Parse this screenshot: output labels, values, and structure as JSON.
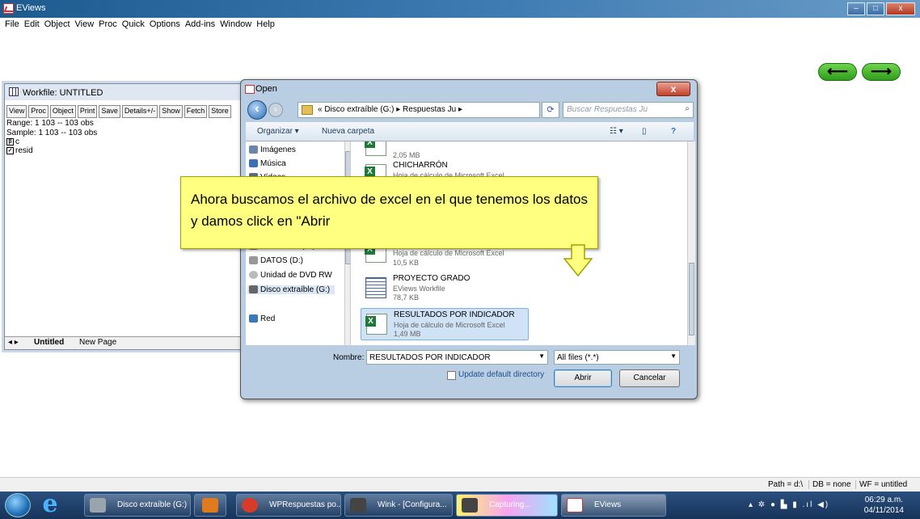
{
  "app": {
    "title": "EViews"
  },
  "window_controls": {
    "minimize": "–",
    "maximize": "□",
    "close": "x"
  },
  "menu": [
    "File",
    "Edit",
    "Object",
    "View",
    "Proc",
    "Quick",
    "Options",
    "Add-ins",
    "Window",
    "Help"
  ],
  "nav_arrows": {
    "back": "⟵",
    "forward": "⟶"
  },
  "workfile": {
    "title": "Workfile: UNTITLED",
    "toolbar": [
      "View",
      "Proc",
      "Object",
      "Print",
      "Save",
      "Details+/-",
      "Show",
      "Fetch",
      "Store"
    ],
    "range": "Range:  1 103  --  103 obs",
    "sample": "Sample: 1 103  --  103 obs",
    "objects": [
      {
        "icon": "β",
        "name": "c"
      },
      {
        "icon": "✓",
        "name": "resid"
      }
    ],
    "tabs": {
      "arrows": "◂ ▸",
      "active": "Untitled",
      "other": "New Page"
    }
  },
  "dialog": {
    "title": "Open",
    "close": "x",
    "address": "« Disco extraíble (G:)  ▸  Respuestas Ju  ▸",
    "search_placeholder": "Buscar Respuestas Ju",
    "toolbar": {
      "organize": "Organizar ▾",
      "new_folder": "Nueva carpeta"
    },
    "nav": [
      {
        "label": "Imágenes",
        "color": "#6b86a8"
      },
      {
        "label": "Música",
        "color": "#3b6fb6"
      },
      {
        "label": "Vídeos",
        "color": "#5a6b80"
      },
      {
        "label": "Disco local (C:)",
        "color": "#888"
      },
      {
        "label": "DATOS (D:)",
        "color": "#999"
      },
      {
        "label": "Unidad de DVD RW",
        "color": "#bbb"
      },
      {
        "label": "Disco extraíble (G:)",
        "color": "#666"
      },
      {
        "label": "Red",
        "color": "#3a78b8"
      }
    ],
    "files": [
      {
        "name": "",
        "type": "",
        "size": "2,05 MB",
        "kind": "xl"
      },
      {
        "name": "CHICHARRÓN",
        "type": "Hoja de cálculo de Microsoft Excel",
        "size": "",
        "kind": "xl"
      },
      {
        "name": "",
        "type": "Hoja de cálculo de Microsoft Excel",
        "size": "10,5 KB",
        "kind": "xl"
      },
      {
        "name": "PROYECTO GRADO",
        "type": "EViews Workfile",
        "size": "78,7 KB",
        "kind": "ev"
      },
      {
        "name": "RESULTADOS POR INDICADOR",
        "type": "Hoja de cálculo de Microsoft Excel",
        "size": "1,49 MB",
        "kind": "xl"
      }
    ],
    "filename_label": "Nombre:",
    "filename_value": "RESULTADOS POR INDICADOR",
    "filter_value": "All files (*.*)",
    "update_default": "Update default directory",
    "open_button": "Abrir",
    "cancel_button": "Cancelar"
  },
  "callout": {
    "text": "Ahora buscamos el archivo de excel en el que tenemos los datos y damos click en \"Abrir"
  },
  "statusbar": {
    "path": "Path = d:\\",
    "db": "DB = none",
    "wf": "WF = untitled"
  },
  "taskbar": {
    "items": [
      {
        "label": "Disco extraíble (G:)",
        "color": "#9aa4ad"
      },
      {
        "label": "",
        "color": "#e07a1f"
      },
      {
        "label": "WPRespuestas po...",
        "color": "#d93b2b"
      },
      {
        "label": "Wink - [Configura...",
        "color": "#444"
      },
      {
        "label": "Capturing...",
        "color": "#444"
      },
      {
        "label": "EViews",
        "color": "#c33"
      }
    ],
    "time": "06:29 a.m.",
    "date": "04/11/2014",
    "tray": "▴  ✲  ●  ▙  ▮  .ıl  ◀)"
  }
}
